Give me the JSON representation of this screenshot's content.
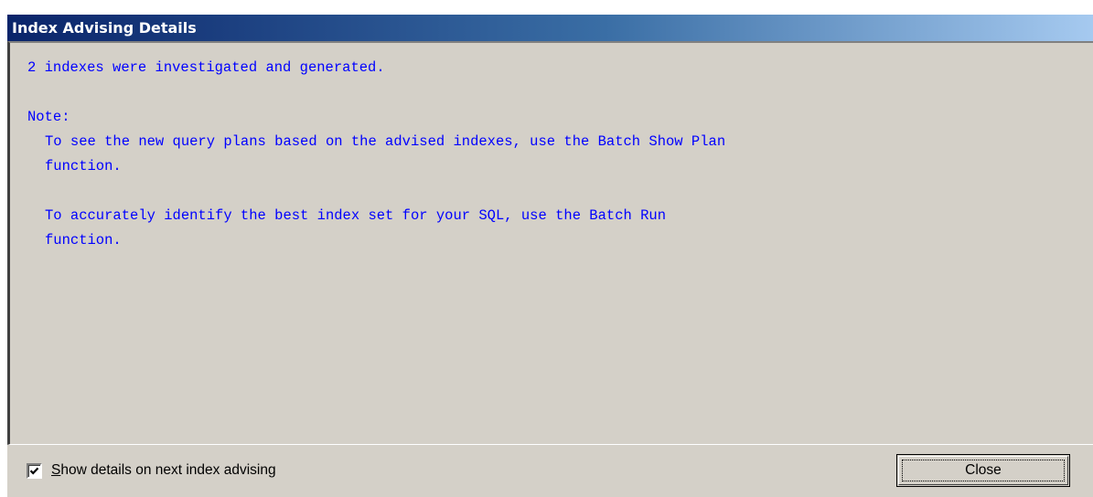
{
  "window": {
    "title": "Index Advising Details"
  },
  "details": {
    "lines": [
      "2 indexes were investigated and generated.",
      "",
      "Note:",
      "To see the new query plans based on the advised indexes, use the Batch Show Plan",
      "function.",
      "",
      "To accurately identify the best index set for your SQL, use the Batch Run",
      "function."
    ]
  },
  "footer": {
    "checkbox": {
      "label": "Show details on next index advising",
      "mnemonic": "S",
      "label_rest": "how details on next index advising",
      "checked": true
    },
    "close_button": {
      "label": "Close"
    }
  },
  "colors": {
    "titlebar_start": "#0a246a",
    "titlebar_end": "#a6caf0",
    "dialog_background": "#d4d0c8",
    "details_text": "#0000ff"
  },
  "icons": {
    "checkbox": "checkmark-icon"
  }
}
